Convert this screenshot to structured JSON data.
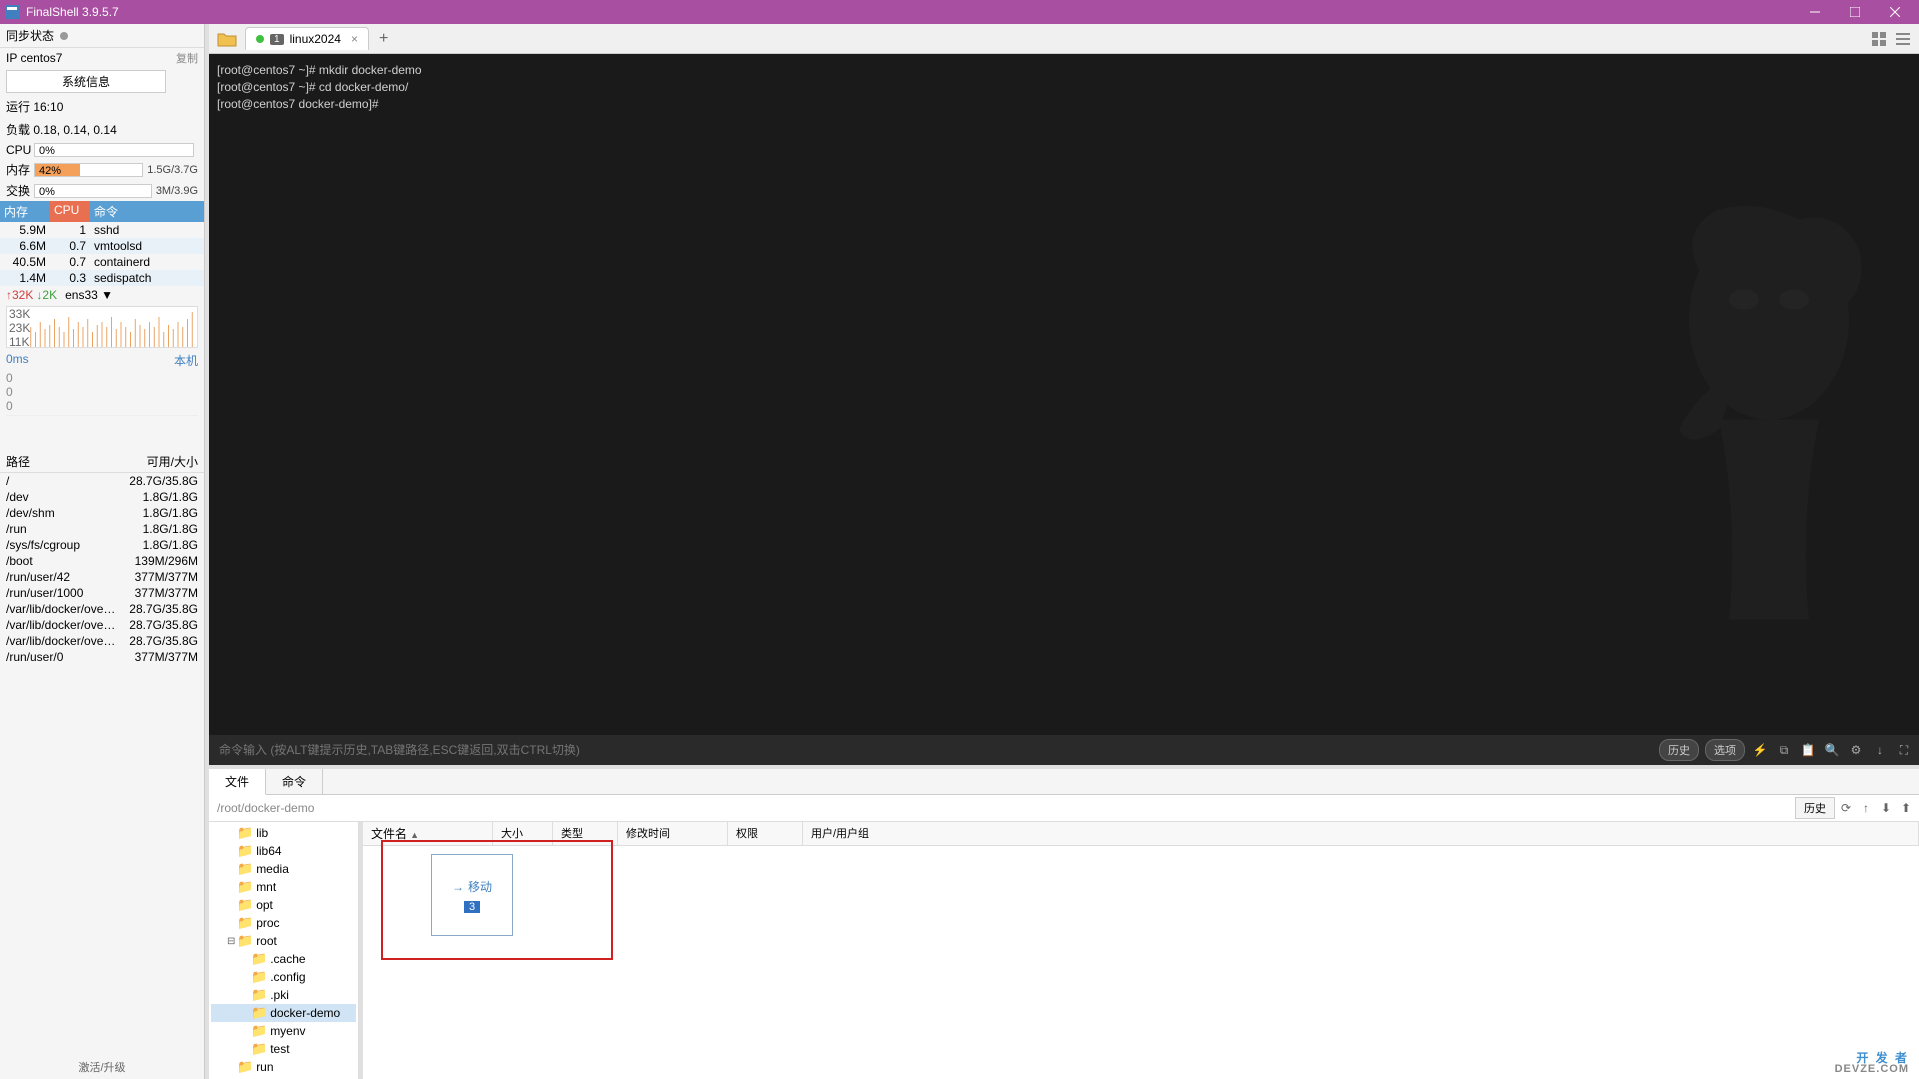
{
  "window": {
    "title": "FinalShell 3.9.5.7"
  },
  "sidebar": {
    "sync_status_label": "同步状态",
    "ip_label": "IP centos7",
    "copy_label": "复制",
    "sysinfo_btn": "系统信息",
    "runtime_label": "运行 16:10",
    "load_label": "负载 0.18, 0.14, 0.14",
    "stats": {
      "cpu_label": "CPU",
      "cpu_pct": "0%",
      "cpu_val": 0,
      "mem_label": "内存",
      "mem_pct": "42%",
      "mem_val": 42,
      "mem_right": "1.5G/3.7G",
      "swap_label": "交换",
      "swap_pct": "0%",
      "swap_val": 0,
      "swap_right": "3M/3.9G"
    },
    "proc_headers": {
      "mem": "内存",
      "cpu": "CPU",
      "cmd": "命令"
    },
    "procs": [
      {
        "mem": "5.9M",
        "cpu": "1",
        "cmd": "sshd"
      },
      {
        "mem": "6.6M",
        "cpu": "0.7",
        "cmd": "vmtoolsd"
      },
      {
        "mem": "40.5M",
        "cpu": "0.7",
        "cmd": "containerd"
      },
      {
        "mem": "1.4M",
        "cpu": "0.3",
        "cmd": "sedispatch"
      }
    ],
    "net": {
      "up": "↑32K",
      "down": "↓2K",
      "iface": "ens33",
      "y_labels": [
        "33K",
        "23K",
        "11K"
      ]
    },
    "latency": {
      "left": "0ms",
      "right": "本机",
      "y_labels": [
        "0",
        "0",
        "0"
      ]
    },
    "disk_headers": {
      "path": "路径",
      "size": "可用/大小"
    },
    "disks": [
      {
        "path": "/",
        "size": "28.7G/35.8G"
      },
      {
        "path": "/dev",
        "size": "1.8G/1.8G"
      },
      {
        "path": "/dev/shm",
        "size": "1.8G/1.8G"
      },
      {
        "path": "/run",
        "size": "1.8G/1.8G"
      },
      {
        "path": "/sys/fs/cgroup",
        "size": "1.8G/1.8G"
      },
      {
        "path": "/boot",
        "size": "139M/296M"
      },
      {
        "path": "/run/user/42",
        "size": "377M/377M"
      },
      {
        "path": "/run/user/1000",
        "size": "377M/377M"
      },
      {
        "path": "/var/lib/docker/overlay..",
        "size": "28.7G/35.8G"
      },
      {
        "path": "/var/lib/docker/overlay..",
        "size": "28.7G/35.8G"
      },
      {
        "path": "/var/lib/docker/overlay..",
        "size": "28.7G/35.8G"
      },
      {
        "path": "/run/user/0",
        "size": "377M/377M"
      }
    ],
    "activate": "激活/升级"
  },
  "tabs": {
    "items": [
      {
        "num": "1",
        "label": "linux2024"
      }
    ]
  },
  "terminal": {
    "lines": [
      "[root@centos7 ~]# mkdir docker-demo",
      "[root@centos7 ~]# cd docker-demo/",
      "[root@centos7 docker-demo]#"
    ]
  },
  "cmdbar": {
    "placeholder": "命令输入 (按ALT键提示历史,TAB键路径,ESC键返回,双击CTRL切换)",
    "history_btn": "历史",
    "options_btn": "选项"
  },
  "bottom": {
    "tabs": {
      "file": "文件",
      "cmd": "命令"
    },
    "path": "/root/docker-demo",
    "history_btn": "历史",
    "columns": {
      "name": "文件名",
      "size": "大小",
      "type": "类型",
      "time": "修改时间",
      "perm": "权限",
      "user": "用户/用户组"
    },
    "tree": [
      {
        "label": "lib",
        "indent": 1
      },
      {
        "label": "lib64",
        "indent": 1
      },
      {
        "label": "media",
        "indent": 1
      },
      {
        "label": "mnt",
        "indent": 1
      },
      {
        "label": "opt",
        "indent": 1
      },
      {
        "label": "proc",
        "indent": 1
      },
      {
        "label": "root",
        "indent": 1,
        "open": true,
        "toggle": "⊟"
      },
      {
        "label": ".cache",
        "indent": 2
      },
      {
        "label": ".config",
        "indent": 2
      },
      {
        "label": ".pki",
        "indent": 2
      },
      {
        "label": "docker-demo",
        "indent": 2,
        "selected": true
      },
      {
        "label": "myenv",
        "indent": 2
      },
      {
        "label": "test",
        "indent": 2
      },
      {
        "label": "run",
        "indent": 1
      }
    ],
    "drop": {
      "label": "移动",
      "count": "3"
    }
  },
  "watermark": {
    "main": "开 发 者",
    "sub": "DEVZE.COM"
  }
}
